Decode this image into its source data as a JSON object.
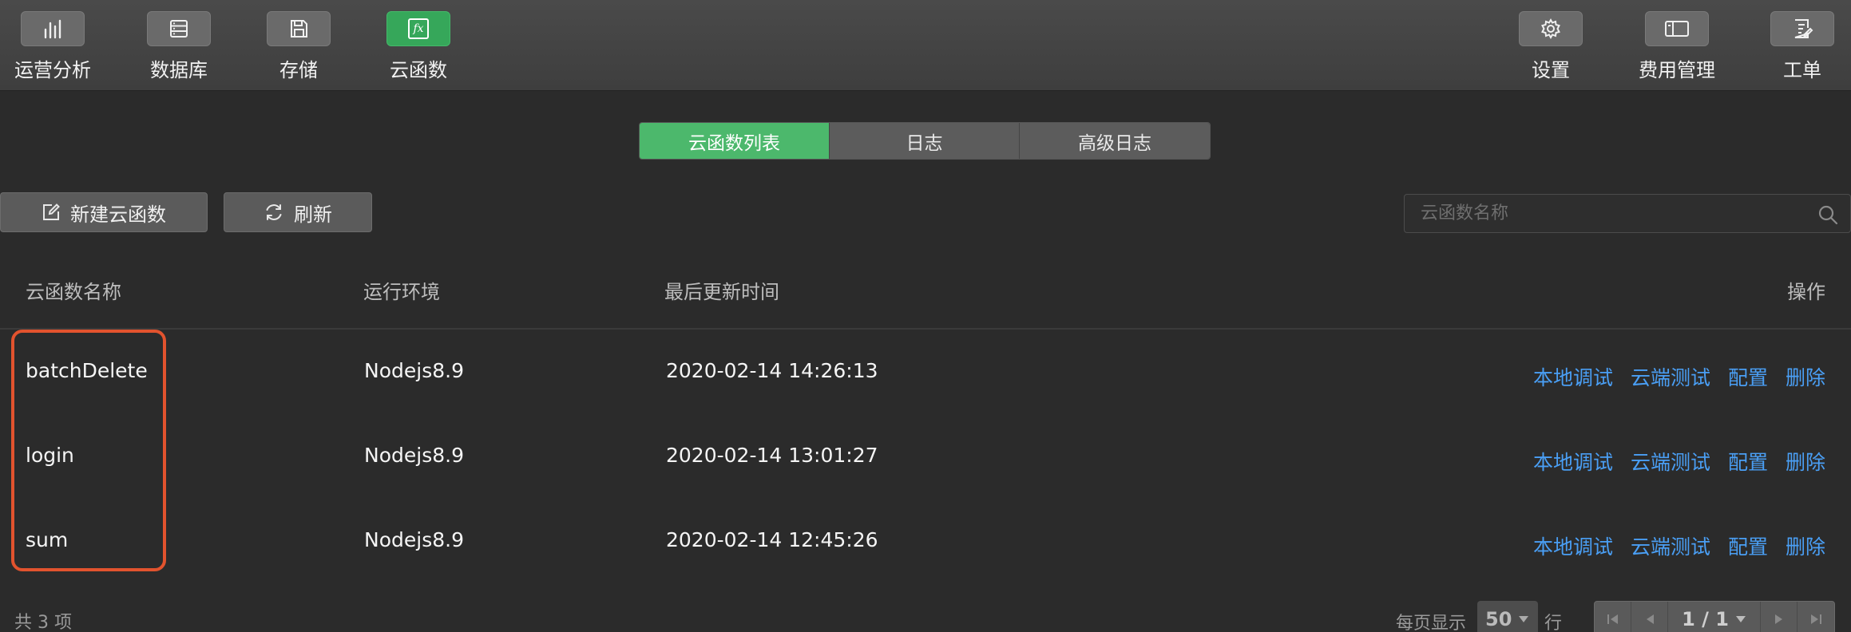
{
  "toolbar": {
    "left": [
      {
        "label": "运营分析",
        "icon": "bar-chart-icon"
      },
      {
        "label": "数据库",
        "icon": "database-icon"
      },
      {
        "label": "存储",
        "icon": "save-icon"
      },
      {
        "label": "云函数",
        "icon": "fx-icon",
        "active": true
      }
    ],
    "right": [
      {
        "label": "设置",
        "icon": "gear-icon"
      },
      {
        "label": "费用管理",
        "icon": "card-icon"
      },
      {
        "label": "工单",
        "icon": "ticket-icon"
      }
    ],
    "fx_glyph": "fx"
  },
  "tabs": [
    {
      "label": "云函数列表",
      "active": true
    },
    {
      "label": "日志"
    },
    {
      "label": "高级日志"
    }
  ],
  "actions": {
    "new_label": "新建云函数",
    "refresh_label": "刷新"
  },
  "search": {
    "placeholder": "云函数名称"
  },
  "table": {
    "headers": {
      "name": "云函数名称",
      "runtime": "运行环境",
      "updated": "最后更新时间",
      "ops": "操作"
    },
    "rows": [
      {
        "name": "batchDelete",
        "runtime": "Nodejs8.9",
        "updated": "2020-02-14 14:26:13"
      },
      {
        "name": "login",
        "runtime": "Nodejs8.9",
        "updated": "2020-02-14 13:01:27"
      },
      {
        "name": "sum",
        "runtime": "Nodejs8.9",
        "updated": "2020-02-14 12:45:26"
      }
    ],
    "ops": [
      "本地调试",
      "云端测试",
      "配置",
      "删除"
    ]
  },
  "footer": {
    "total": "共 3 项",
    "per_page_label": "每页显示",
    "per_page_value": "50",
    "per_page_tail": "行",
    "page_info": "1 / 1"
  },
  "colors": {
    "accent_green": "#4cb86c",
    "link_blue": "#4a9ff5",
    "highlight_red": "#e2532e"
  }
}
